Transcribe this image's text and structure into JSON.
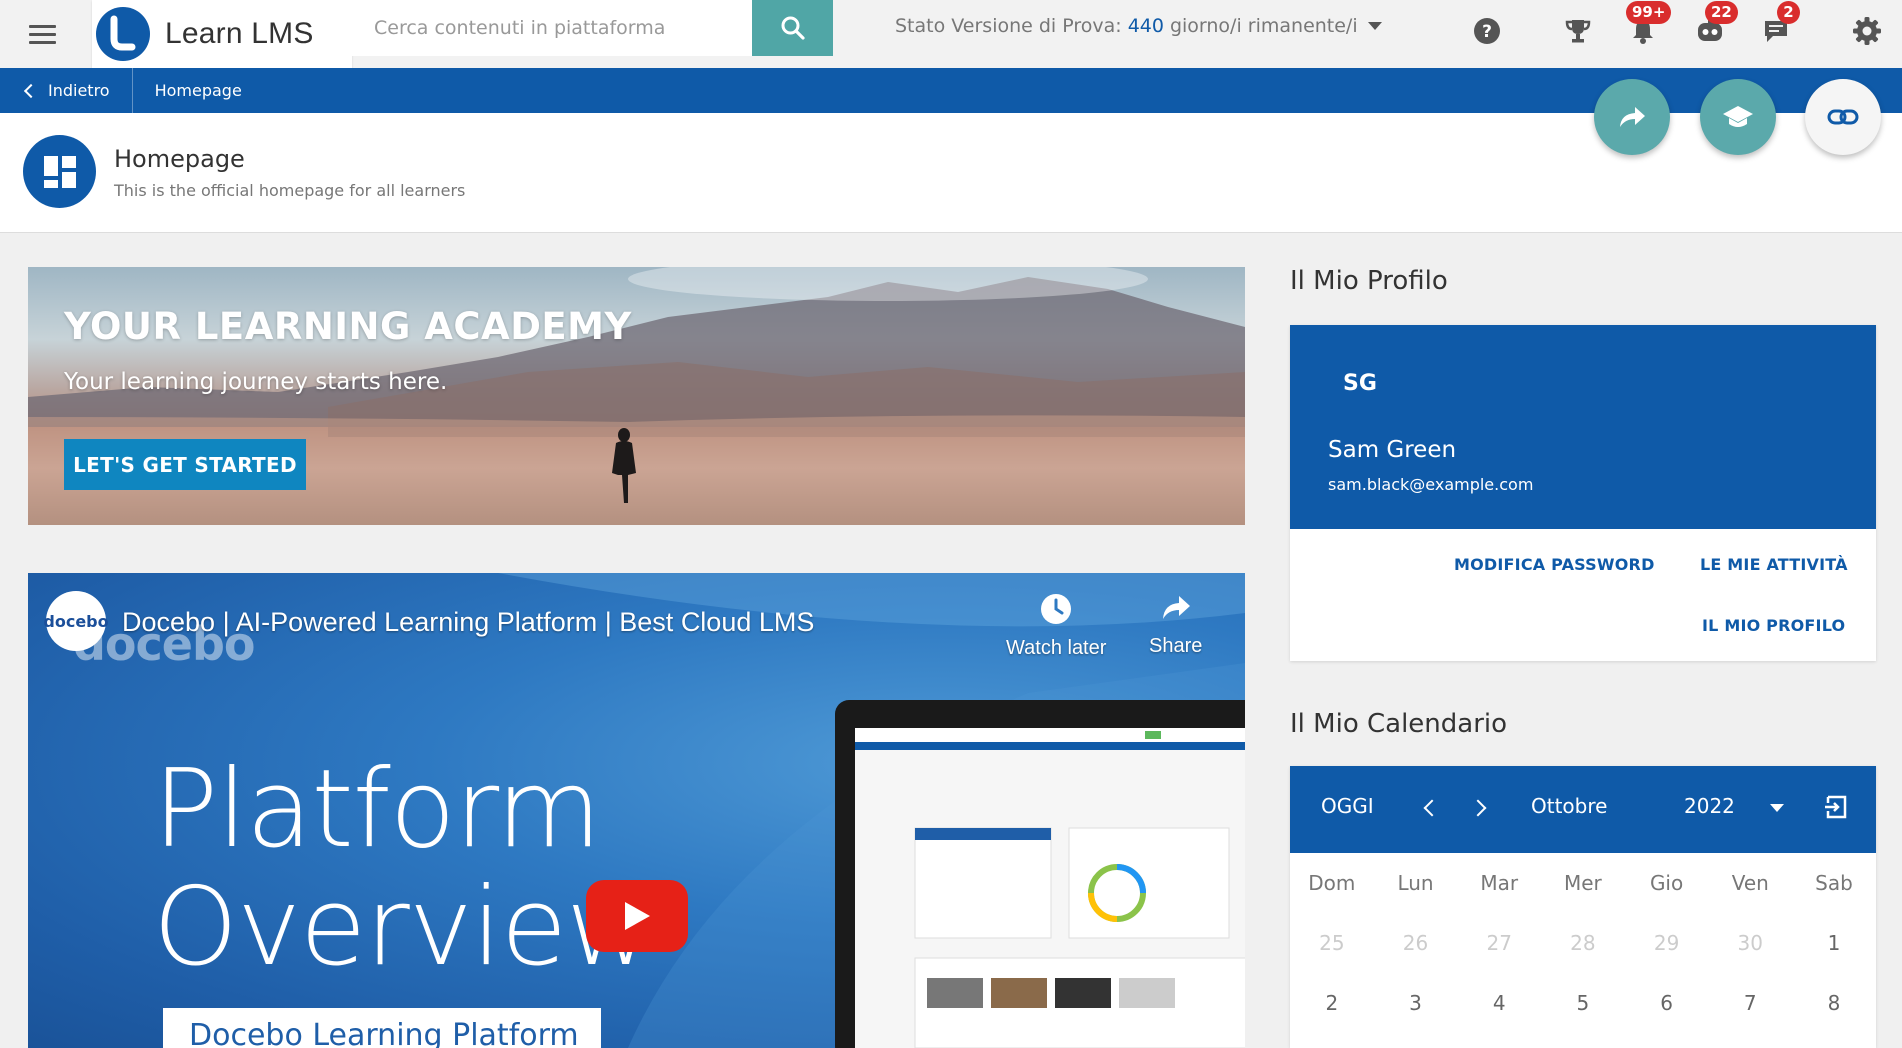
{
  "app": {
    "name": "Learn LMS"
  },
  "search": {
    "placeholder": "Cerca contenuti in piattaforma"
  },
  "trial": {
    "prefix": "Stato Versione di Prova:",
    "days": "440",
    "suffix": "giorno/i rimanente/i"
  },
  "topbar_icons": {
    "help": "help-icon",
    "gamification": "trophy-icon",
    "notifications": {
      "icon": "bell-icon",
      "badge": "99+"
    },
    "messages": {
      "icon": "assistant-icon",
      "badge": "22"
    },
    "chat": {
      "icon": "chat-icon",
      "badge": "2"
    },
    "settings": "gear-icon"
  },
  "breadcrumb": {
    "back": "Indietro",
    "current": "Homepage"
  },
  "page": {
    "title": "Homepage",
    "subtitle": "This is the official homepage for all learners"
  },
  "banner": {
    "title": "YOUR LEARNING ACADEMY",
    "subtitle": "Your learning journey starts here.",
    "button": "LET'S GET STARTED"
  },
  "video": {
    "channel_avatar": "docebo",
    "channel_logo": "docebo",
    "title": "Docebo | AI-Powered Learning Platform | Best Cloud LMS",
    "watch_later": "Watch later",
    "share": "Share",
    "overlay_line1": "Platform",
    "overlay_line2": "Overview",
    "overlay_caption": "Docebo Learning Platform"
  },
  "profile": {
    "section_title": "Il Mio Profilo",
    "initials": "SG",
    "name": "Sam Green",
    "email": "sam.black@example.com",
    "links": {
      "change_password": "MODIFICA PASSWORD",
      "activities": "LE MIE ATTIVITÀ",
      "my_profile": "IL MIO PROFILO"
    }
  },
  "calendar": {
    "section_title": "Il Mio Calendario",
    "today": "OGGI",
    "month": "Ottobre",
    "year": "2022",
    "weekdays": [
      "Dom",
      "Lun",
      "Mar",
      "Mer",
      "Gio",
      "Ven",
      "Sab"
    ],
    "week1": [
      "25",
      "26",
      "27",
      "28",
      "29",
      "30",
      "1"
    ],
    "week2": [
      "2",
      "3",
      "4",
      "5",
      "6",
      "7",
      "8"
    ]
  },
  "colors": {
    "primary": "#0f5aa8",
    "teal": "#50a6a6",
    "badge": "#d92d2d",
    "youtube_red": "#e62117"
  }
}
